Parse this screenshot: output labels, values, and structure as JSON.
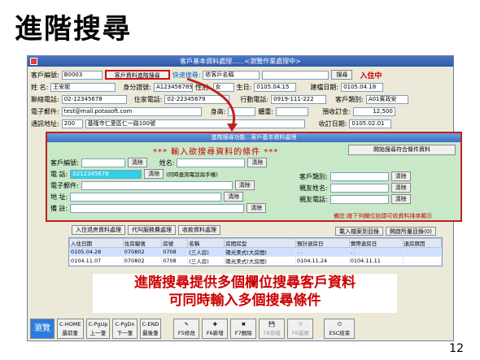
{
  "slide": {
    "title": "進階搜尋",
    "page": "12"
  },
  "window": {
    "title": "客戶基本資料處理......<瀏覽作業處理中>"
  },
  "main": {
    "cust_no_label": "客戶編號:",
    "cust_no": "B0003",
    "adv_search_btn": "客戶資料進階搜尋",
    "quick_label": "快速搜尋:",
    "quick_value": "依客戶名稱",
    "search_btn": "搜尋",
    "status": "入住中",
    "name_label": "姓    名:",
    "name": "王安妮",
    "id_label": "身分證號:",
    "id_no": "A123456789",
    "gender_label": "性別:",
    "gender": "女",
    "birth_label": "生日:",
    "birth": "0105.04.15",
    "created_label": "建檔日期:",
    "created": "0105.04.18",
    "phone_label": "聯絡電話:",
    "phone": "02-12345678",
    "home_phone_label": "住家電話:",
    "home_phone": "02-22345679",
    "mobile_label": "行動電話:",
    "mobile": "0919-111-222",
    "type_label": "客戶類別:",
    "type": "A01賓政安",
    "email_label": "電子郵件:",
    "email": "test@mail.potasoft.com",
    "height_label": "身高:",
    "weight_label": "體重:",
    "deposit_label": "預收訂金:",
    "deposit": "12,500",
    "addr_label": "通訊地址:",
    "zip": "200",
    "addr": "基隆市仁愛區仁一路100號",
    "collect_label": "收訂日期:",
    "collect": "0105.02.01"
  },
  "dialog": {
    "title": "進階搜尋功能...客戶基本資料處理",
    "heading": "*** 輸入欲搜尋資料的條件 ***",
    "start_btn": "開始搜尋符合條件資料",
    "cust_no": "客戶編號:",
    "name": "姓名:",
    "phone": "電    話:",
    "phone_value": "0212345678",
    "phone_hint": "(同時查詢電話與手機)",
    "email": "電子郵件:",
    "addr": "地    址:",
    "note": "備    註:",
    "type": "客戶類別:",
    "relative_name": "親友姓名:",
    "relative_phone": "親友電話:",
    "clear": "清除",
    "footer_note": "備註:按下列欄位抬頭可依資料排序顯示"
  },
  "tabs": [
    "入住退房資料處理",
    "代叫服務費處理",
    "收款資料處理"
  ],
  "side_buttons": [
    "載入檔案到目錄",
    "開啟所屬目錄(0)"
  ],
  "grid": {
    "headers": [
      "入住日期",
      "住房編號",
      "房號",
      "名稱",
      "房間房型",
      "預計退房日",
      "實際退房日",
      "退房原因"
    ],
    "rows": [
      [
        "0105.04.28",
        "070802",
        "0708",
        "(三人房)",
        "陽光美式(大房間)",
        ".  .",
        ".  .",
        ""
      ],
      [
        "0104.11.07",
        "070802",
        "0708",
        "(三人房)",
        "陽光美式(大房間)",
        "0104.11.24",
        "0104.11.11",
        ""
      ]
    ]
  },
  "callout": {
    "line1": "進階搜尋提供多個欄位搜尋客戶資料",
    "line2": "可同時輸入多個搜尋條件"
  },
  "keys": [
    {
      "l1": "瀏覽",
      "l2": ""
    },
    {
      "l1": "C-HOME",
      "l2": "最前筆"
    },
    {
      "l1": "C-PgUp",
      "l2": "上一筆"
    },
    {
      "l1": "C-PgDn",
      "l2": "下一筆"
    },
    {
      "l1": "C-END",
      "l2": "最後筆"
    },
    {
      "l1": "F5修改",
      "l2": ""
    },
    {
      "l1": "F6新增",
      "l2": ""
    },
    {
      "l1": "F7刪除",
      "l2": ""
    },
    {
      "l1": "F8存檔",
      "l2": ""
    },
    {
      "l1": "F9還原",
      "l2": ""
    },
    {
      "l1": "ESC結束",
      "l2": ""
    }
  ]
}
